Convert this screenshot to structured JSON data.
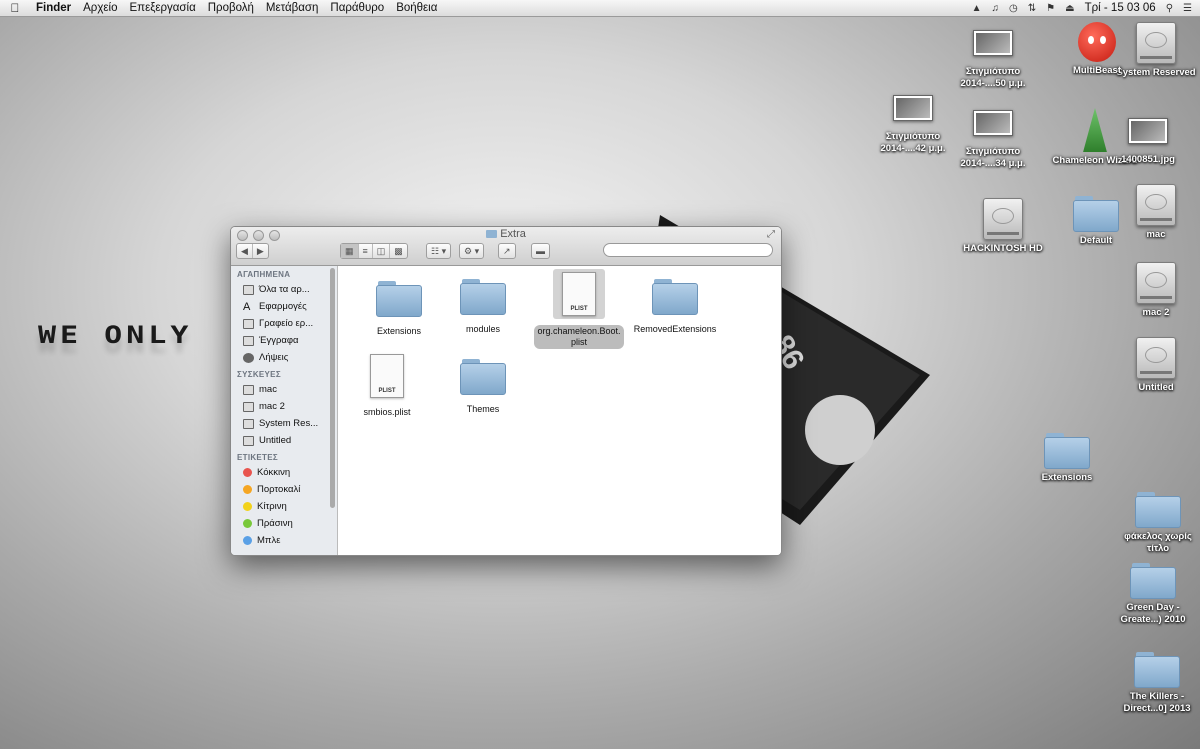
{
  "menubar": {
    "items": [
      "Finder",
      "Αρχείο",
      "Επεξεργασία",
      "Προβολή",
      "Μετάβαση",
      "Παράθυρο",
      "Βοήθεια"
    ],
    "clock": "Τρί - 15 03 06"
  },
  "wallpaper": {
    "text": "WE ONLY"
  },
  "desktop": {
    "icons": [
      {
        "label": "System Reserved",
        "type": "hdd"
      },
      {
        "label": "MultiBeast",
        "type": "app"
      },
      {
        "label": "Στιγμιότυπο 2014-....50 μ.μ.",
        "type": "screenshot"
      },
      {
        "label": "Στιγμιότυπο 2014-....42 μ.μ.",
        "type": "screenshot"
      },
      {
        "label": "Στιγμιότυπο 2014-....34 μ.μ.",
        "type": "screenshot"
      },
      {
        "label": "Chameleon Wizard",
        "type": "app"
      },
      {
        "label": "1400851.jpg",
        "type": "screenshot"
      },
      {
        "label": "HACKINTOSH HD",
        "type": "hdd"
      },
      {
        "label": "Default",
        "type": "folder"
      },
      {
        "label": "mac",
        "type": "hdd"
      },
      {
        "label": "mac 2",
        "type": "hdd"
      },
      {
        "label": "Untitled",
        "type": "hdd"
      },
      {
        "label": "Extensions",
        "type": "folder"
      },
      {
        "label": "φάκελος χωρίς τίτλο",
        "type": "folder"
      },
      {
        "label": "Green Day - Greate...) 2010",
        "type": "folder"
      },
      {
        "label": "The Killers - Direct...0] 2013",
        "type": "folder"
      }
    ]
  },
  "finder": {
    "title": "Extra",
    "search_placeholder": "",
    "sidebar": {
      "favorites_header": "ΑΓΑΠΗΜΕΝΑ",
      "favorites": [
        "Όλα τα αρ...",
        "Εφαρμογές",
        "Γραφείο ερ...",
        "Έγγραφα",
        "Λήψεις"
      ],
      "devices_header": "ΣΥΣΚΕΥΕΣ",
      "devices": [
        "mac",
        "mac 2",
        "System Res...",
        "Untitled"
      ],
      "tags_header": "ΕΤΙΚΕΤΕΣ",
      "tags": [
        {
          "label": "Κόκκινη",
          "color": "#e8544e"
        },
        {
          "label": "Πορτοκαλί",
          "color": "#f5a623"
        },
        {
          "label": "Κίτρινη",
          "color": "#f2d21b"
        },
        {
          "label": "Πράσινη",
          "color": "#79c83a"
        },
        {
          "label": "Μπλε",
          "color": "#5aa0e6"
        }
      ]
    },
    "files": [
      {
        "name": "Extensions",
        "type": "folder"
      },
      {
        "name": "modules",
        "type": "folder"
      },
      {
        "name": "org.chameleon.Boot.plist",
        "type": "plist",
        "selected": true,
        "badge": "PLIST"
      },
      {
        "name": "RemovedExtensions",
        "type": "folder"
      },
      {
        "name": "smbios.plist",
        "type": "plist",
        "badge": "PLIST"
      },
      {
        "name": "Themes",
        "type": "folder"
      }
    ]
  }
}
